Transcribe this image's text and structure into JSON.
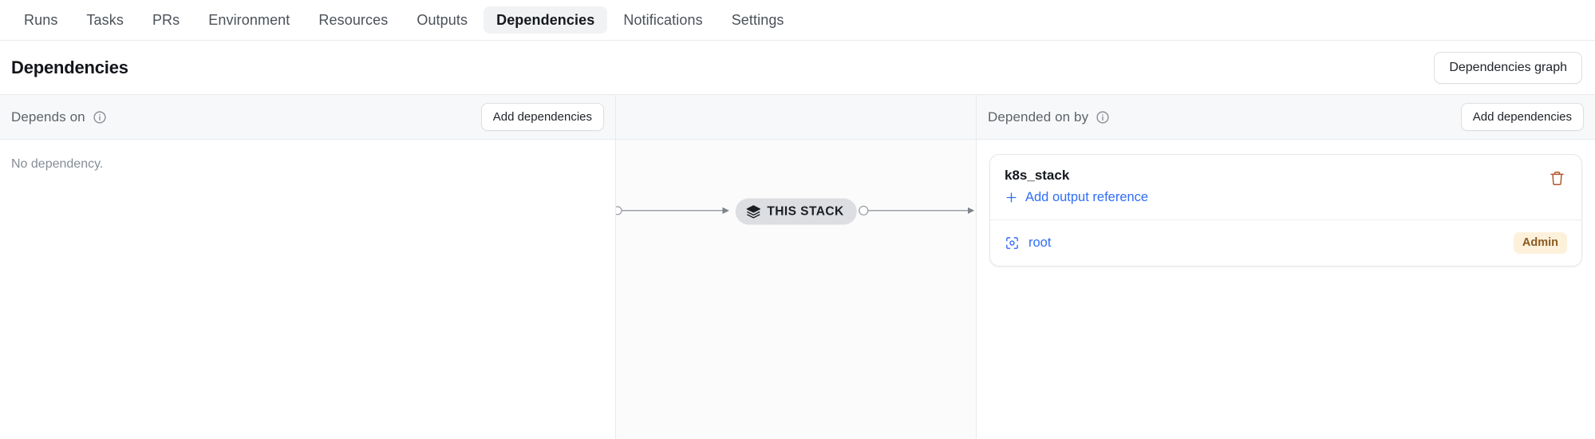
{
  "tabs": [
    {
      "label": "Runs",
      "active": false
    },
    {
      "label": "Tasks",
      "active": false
    },
    {
      "label": "PRs",
      "active": false
    },
    {
      "label": "Environment",
      "active": false
    },
    {
      "label": "Resources",
      "active": false
    },
    {
      "label": "Outputs",
      "active": false
    },
    {
      "label": "Dependencies",
      "active": true
    },
    {
      "label": "Notifications",
      "active": false
    },
    {
      "label": "Settings",
      "active": false
    }
  ],
  "header": {
    "title": "Dependencies",
    "graph_button": "Dependencies graph"
  },
  "depends_on": {
    "title": "Depends on",
    "info_icon": "info-circle-icon",
    "add_button": "Add dependencies",
    "empty_text": "No dependency."
  },
  "graph": {
    "stack_label": "THIS STACK",
    "stack_icon": "layers-icon"
  },
  "depended_on_by": {
    "title": "Depended on by",
    "info_icon": "info-circle-icon",
    "add_button": "Add dependencies",
    "cards": [
      {
        "name": "k8s_stack",
        "add_output_reference": "Add output reference",
        "add_icon": "plus-icon",
        "delete_icon": "trash-icon",
        "rows": [
          {
            "label": "root",
            "icon": "scan-target-icon",
            "badge": "Admin"
          }
        ]
      }
    ]
  },
  "colors": {
    "accent_link": "#2f6df6",
    "badge_bg": "#fdf1dc",
    "badge_text": "#8a5a20",
    "delete": "#b2562e",
    "tab_active_bg": "#f1f2f4",
    "pill_bg": "#dcdee1"
  }
}
